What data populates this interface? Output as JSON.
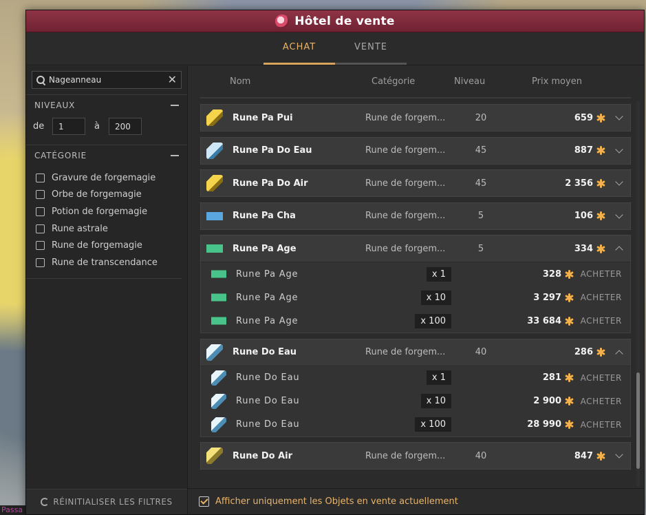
{
  "window": {
    "title": "Hôtel de vente",
    "tabs": [
      {
        "label": "ACHAT",
        "active": true
      },
      {
        "label": "VENTE",
        "active": false
      }
    ]
  },
  "sidebar": {
    "search": {
      "value": "Nageanneau"
    },
    "levels": {
      "heading": "NIVEAUX",
      "from_label": "de",
      "from_value": "1",
      "to_label": "à",
      "to_value": "200"
    },
    "category": {
      "heading": "CATÉGORIE",
      "items": [
        "Gravure de forgemagie",
        "Orbe de forgemagie",
        "Potion de forgemagie",
        "Rune astrale",
        "Rune de forgemagie",
        "Rune de transcendance"
      ]
    },
    "reset_label": "RÉINITIALISER LES FILTRES"
  },
  "table": {
    "columns": {
      "name": "Nom",
      "category": "Catégorie",
      "level": "Niveau",
      "price": "Prix moyen"
    },
    "rows": [
      {
        "name": "Rune Pa Pui",
        "category": "Rune de forgem...",
        "level": "20",
        "price": "659",
        "icon": "rune-gold-icon",
        "expanded": false
      },
      {
        "name": "Rune Pa Do Eau",
        "category": "Rune de forgem...",
        "level": "45",
        "price": "887",
        "icon": "rune-blue-icon",
        "expanded": false
      },
      {
        "name": "Rune Pa Do Air",
        "category": "Rune de forgem...",
        "level": "45",
        "price": "2 356",
        "icon": "rune-gold-icon",
        "expanded": false
      },
      {
        "name": "Rune Pa Cha",
        "category": "Rune de forgem...",
        "level": "5",
        "price": "106",
        "icon": "rune-cha-icon",
        "expanded": false
      },
      {
        "name": "Rune Pa Age",
        "category": "Rune de forgem...",
        "level": "5",
        "price": "334",
        "icon": "rune-age-icon",
        "expanded": true,
        "offers": [
          {
            "name": "Rune Pa Age",
            "qty": "x 1",
            "price": "328",
            "action": "ACHETER"
          },
          {
            "name": "Rune Pa Age",
            "qty": "x 10",
            "price": "3 297",
            "action": "ACHETER"
          },
          {
            "name": "Rune Pa Age",
            "qty": "x 100",
            "price": "33 684",
            "action": "ACHETER"
          }
        ]
      },
      {
        "name": "Rune Do Eau",
        "category": "Rune de forgem...",
        "level": "40",
        "price": "286",
        "icon": "rune-doeau-icon",
        "expanded": true,
        "offers": [
          {
            "name": "Rune Do Eau",
            "qty": "x 1",
            "price": "281",
            "action": "ACHETER"
          },
          {
            "name": "Rune Do Eau",
            "qty": "x 10",
            "price": "2 900",
            "action": "ACHETER"
          },
          {
            "name": "Rune Do Eau",
            "qty": "x 100",
            "price": "28 990",
            "action": "ACHETER"
          }
        ]
      },
      {
        "name": "Rune Do Air",
        "category": "Rune de forgem...",
        "level": "40",
        "price": "847",
        "icon": "rune-doair-icon",
        "expanded": false
      }
    ]
  },
  "footer": {
    "checkbox_label": "Afficher uniquement les Objets en vente actuellement",
    "checked": true
  },
  "background": {
    "text": "Passa"
  },
  "colors": {
    "accent": "#e8b46a",
    "titlebar": "#8f3446",
    "panel": "#2b2b2b"
  }
}
